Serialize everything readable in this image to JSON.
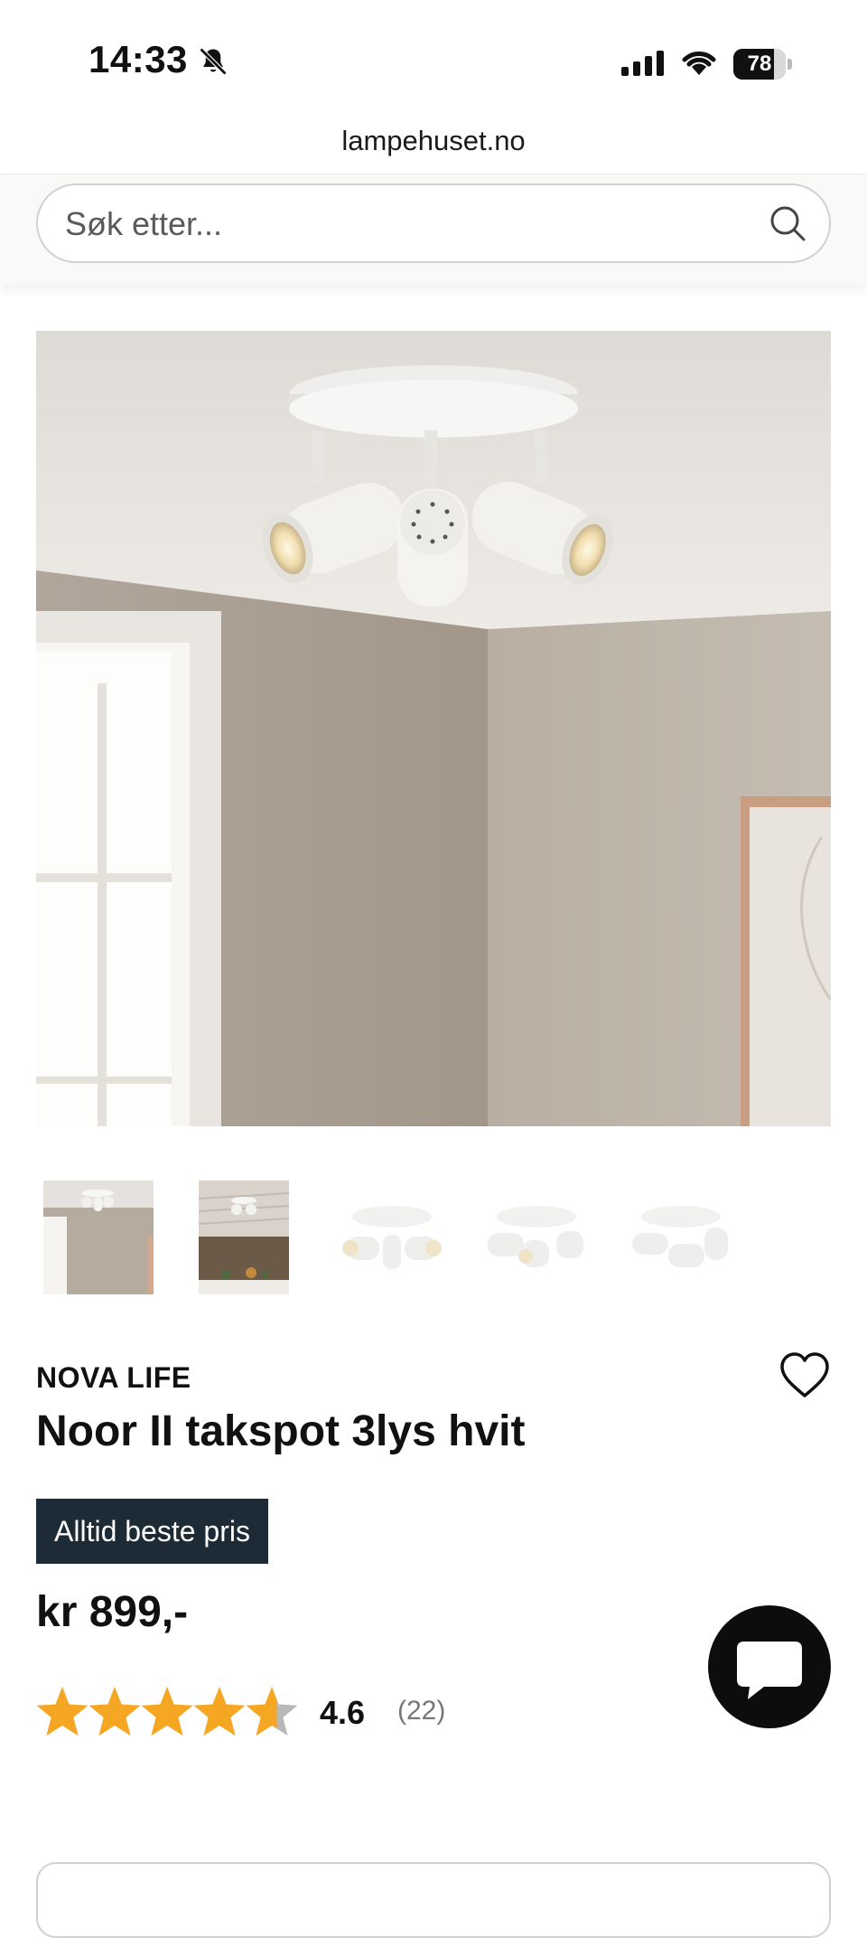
{
  "status_bar": {
    "time": "14:33",
    "battery_level": "78",
    "battery_fraction": 0.78
  },
  "browser": {
    "url": "lampehuset.no"
  },
  "search": {
    "placeholder": "Søk etter..."
  },
  "product": {
    "brand": "NOVA LIFE",
    "title": "Noor II takspot 3lys hvit",
    "badge": "Alltid beste pris",
    "price": "kr 899,-",
    "rating": 4.6,
    "rating_value": "4.6",
    "review_count": "(22)"
  },
  "colors": {
    "badge_background": "#1c2b35",
    "star": "#f5a623",
    "chat_button": "#0d0d0d"
  },
  "icons": {
    "search": "search-icon",
    "favorite": "heart-icon",
    "chat": "chat-icon",
    "mute": "bell-off-icon"
  }
}
